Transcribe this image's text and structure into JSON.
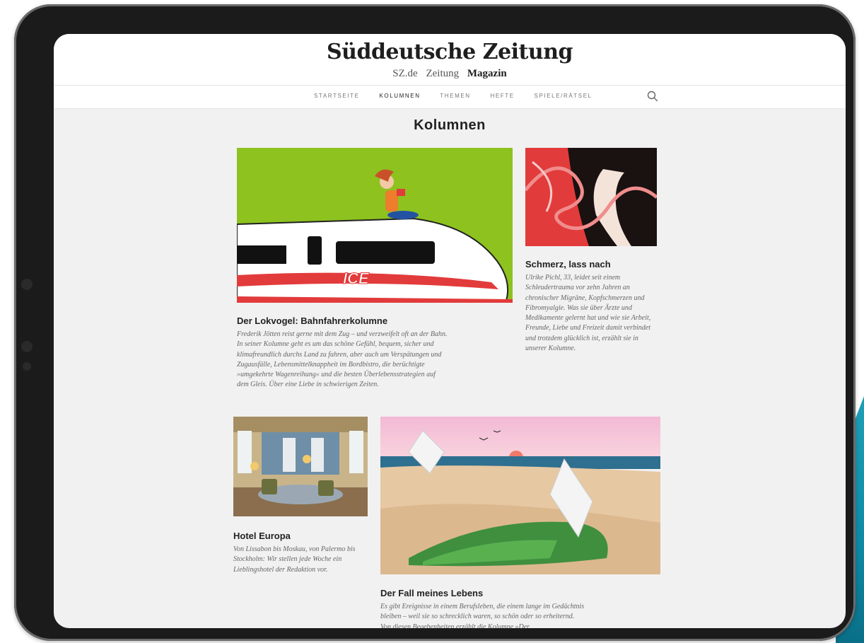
{
  "masthead": {
    "logo": "Süddeutsche Zeitung",
    "submenu": [
      "SZ.de",
      "Zeitung",
      "Magazin"
    ]
  },
  "nav": {
    "items": [
      "STARTSEITE",
      "KOLUMNEN",
      "THEMEN",
      "HEFTE",
      "SPIELE/RÄTSEL"
    ]
  },
  "page": {
    "title": "Kolumnen"
  },
  "cards": [
    {
      "title": "Der Lokvogel: Bahnfahrerkolumne",
      "description": "Frederik Jötten reist gerne mit dem Zug – und verzweifelt oft an der Bahn. In seiner Kolumne geht es um das schöne Gefühl, bequem, sicher und klimafreundlich durchs Land zu fahren, aber auch um Verspätungen und Zugausfälle, Lebensmittelknappheit im Bordbistro, die berüchtigte »umgekehrte Wagenreihung« und die besten Überlebensstrategien auf dem Gleis. Über eine Liebe in schwierigen Zeiten.",
      "image_text": "ICE"
    },
    {
      "title": "Schmerz, lass nach",
      "description": "Ulrike Pichl, 33, leidet seit einem Schleudertrauma vor zehn Jahren an chronischer Migräne, Kopfschmerzen und Fibromyalgie. Was sie über Ärzte und Medikamente gelernt hat und wie sie Arbeit, Freunde, Liebe und Freizeit damit verbindet und trotzdem glücklich ist, erzählt sie in unserer Kolumne."
    },
    {
      "title": "Hotel Europa",
      "description": "Von Lissabon bis Moskau, von Palermo bis Stockholm: Wir stellen jede Woche ein Lieblingshotel der Redaktion vor."
    },
    {
      "title": "Der Fall meines Lebens",
      "description": "Es gibt Ereignisse in einem Berufsleben, die einem lange im Gedächtnis bleiben – weil sie so schrecklich waren, so schön oder so erheiternd. Von diesen Begebenheiten erzählt die Kolumne »Der"
    }
  ],
  "colors": {
    "accent_green": "#8dc21f",
    "accent_red": "#e23b3b",
    "teal": "#1591ad"
  }
}
